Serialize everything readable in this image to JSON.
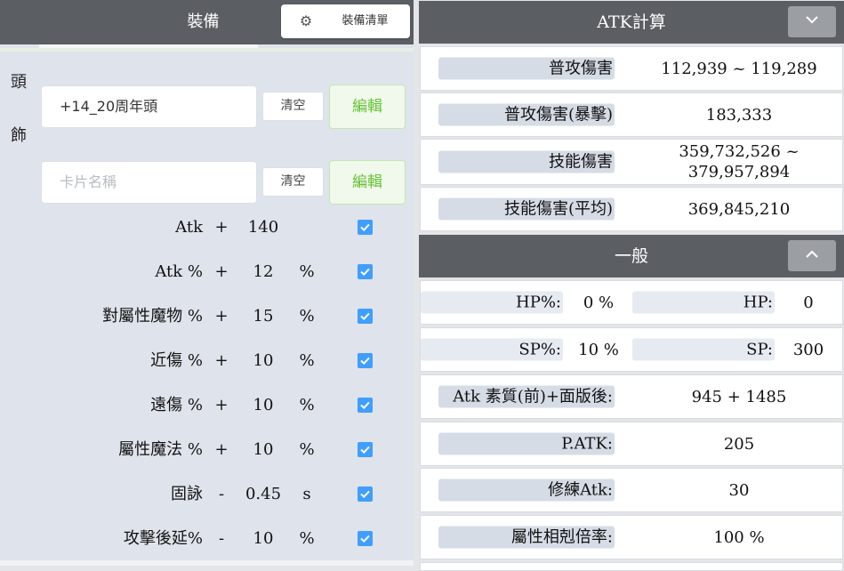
{
  "left": {
    "header_title": "裝備",
    "equip_list_button": "裝備清單",
    "slot_label_top": "頭",
    "slot_label_bottom": "飾",
    "equip_input_value": "+14_20周年頭",
    "card_input_placeholder": "卡片名稱",
    "clear_label": "清空",
    "edit_label": "編輯",
    "stats": [
      {
        "name": "Atk",
        "op": "+",
        "value": "140",
        "unit": "",
        "checked": true
      },
      {
        "name": "Atk %",
        "op": "+",
        "value": "12",
        "unit": "%",
        "checked": true
      },
      {
        "name": "對屬性魔物 %",
        "op": "+",
        "value": "15",
        "unit": "%",
        "checked": true
      },
      {
        "name": "近傷 %",
        "op": "+",
        "value": "10",
        "unit": "%",
        "checked": true
      },
      {
        "name": "遠傷 %",
        "op": "+",
        "value": "10",
        "unit": "%",
        "checked": true
      },
      {
        "name": "屬性魔法 %",
        "op": "+",
        "value": "10",
        "unit": "%",
        "checked": true
      },
      {
        "name": "固詠",
        "op": "-",
        "value": "0.45",
        "unit": "s",
        "checked": true
      },
      {
        "name": "攻擊後延%",
        "op": "-",
        "value": "10",
        "unit": "%",
        "checked": true
      }
    ]
  },
  "right": {
    "atk_title": "ATK計算",
    "atk_rows": [
      {
        "label": "普攻傷害",
        "value": "112,939 ~ 119,289"
      },
      {
        "label": "普攻傷害(暴擊)",
        "value": "183,333"
      },
      {
        "label": "技能傷害",
        "value": "359,732,526 ~ 379,957,894"
      },
      {
        "label": "技能傷害(平均)",
        "value": "369,845,210"
      }
    ],
    "general_title": "一般",
    "hp_pct_label": "HP%:",
    "hp_pct_value": "0 %",
    "hp_label": "HP:",
    "hp_value": "0",
    "sp_pct_label": "SP%:",
    "sp_pct_value": "10 %",
    "sp_label": "SP:",
    "sp_value": "300",
    "general_rows": [
      {
        "label": "Atk 素質(前)+面版後:",
        "value": "945 + 1485"
      },
      {
        "label": "P.ATK:",
        "value": "205"
      },
      {
        "label": "修練Atk:",
        "value": "30"
      },
      {
        "label": "屬性相剋倍率:",
        "value": "100 %"
      }
    ]
  }
}
